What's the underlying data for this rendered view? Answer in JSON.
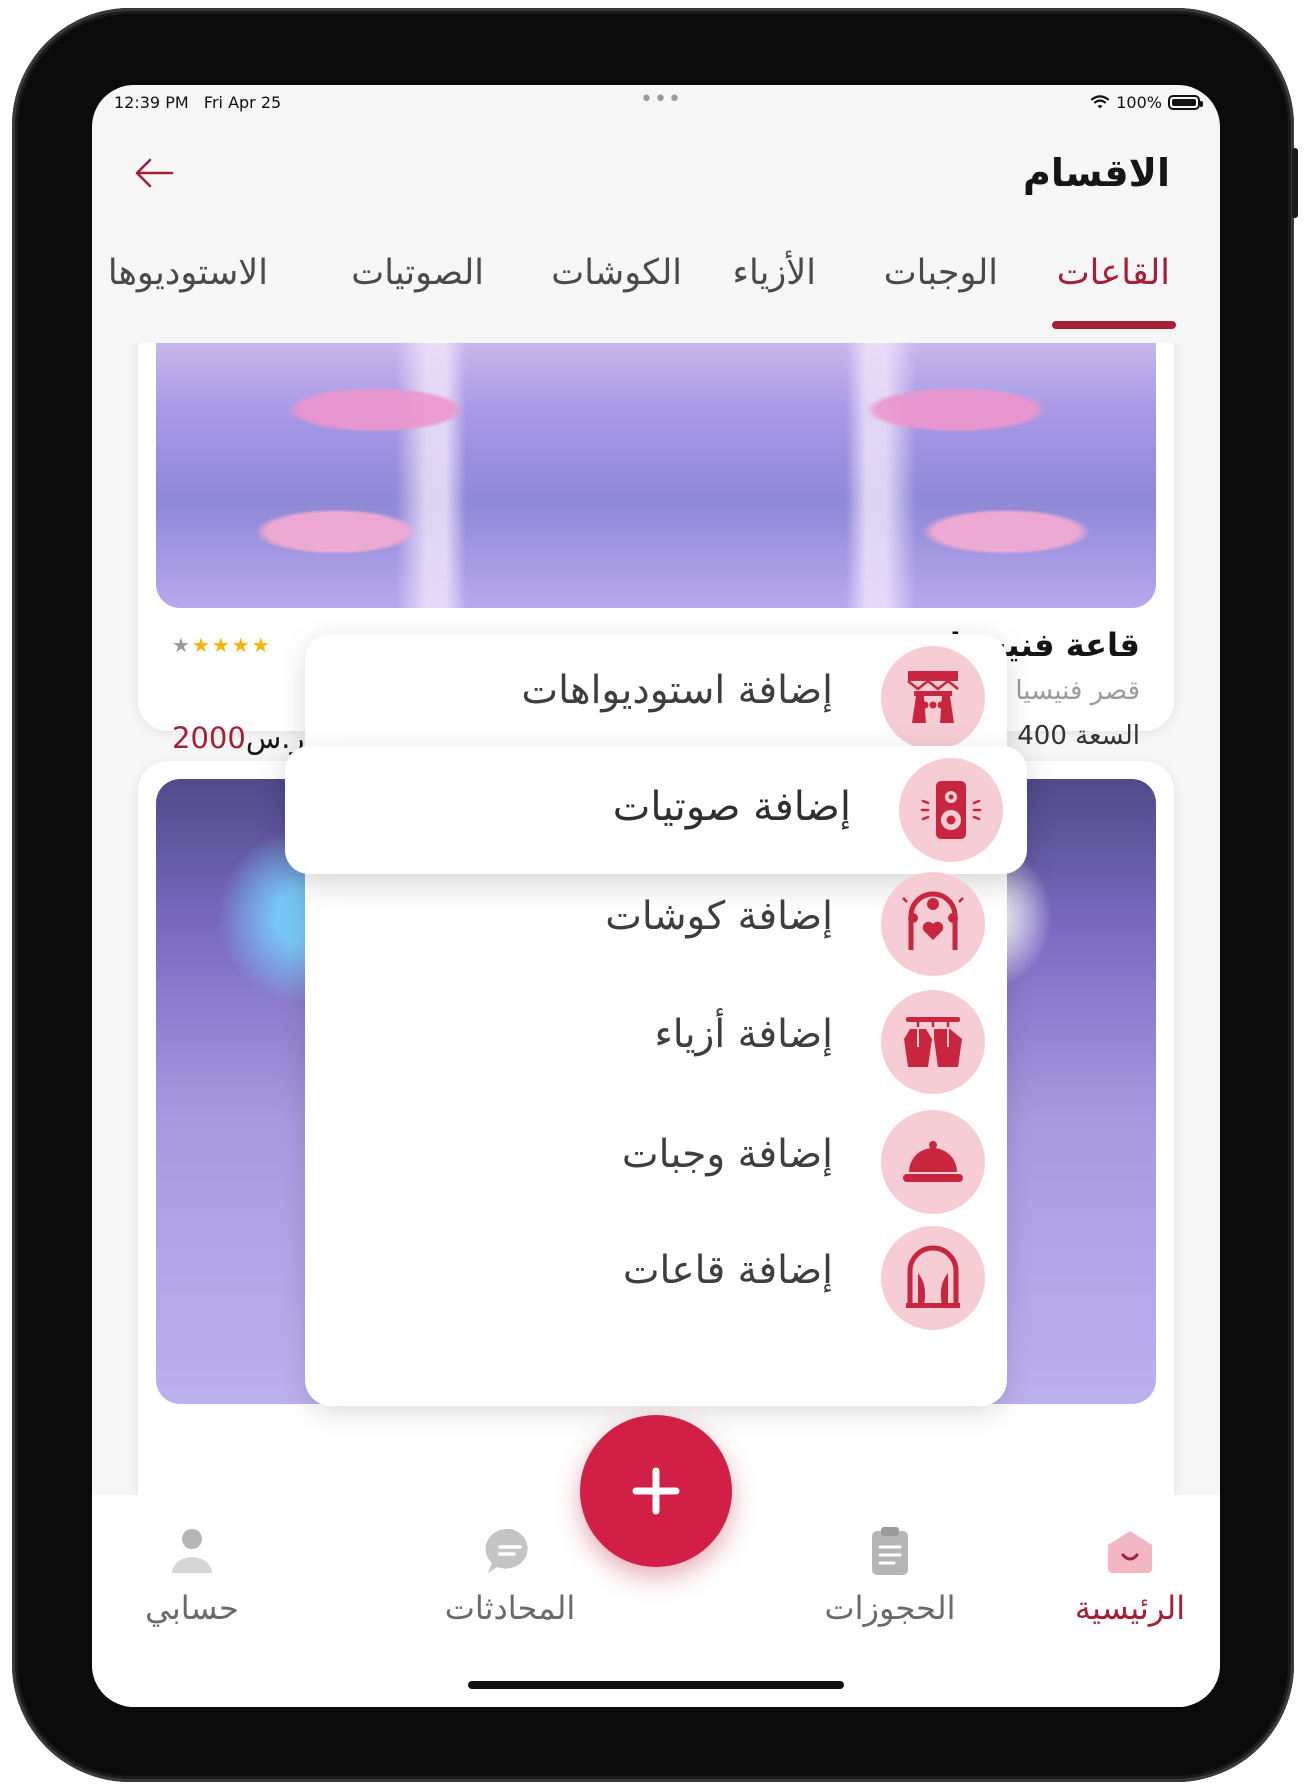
{
  "status_bar": {
    "time": "12:39 PM",
    "date": "Fri Apr 25",
    "battery": "100%"
  },
  "header": {
    "title": "الاقسام"
  },
  "tabs": [
    {
      "label": "القاعات",
      "active": true
    },
    {
      "label": "الوجبات",
      "active": false
    },
    {
      "label": "الأزياء",
      "active": false
    },
    {
      "label": "الكوشات",
      "active": false
    },
    {
      "label": "الصوتيات",
      "active": false
    },
    {
      "label": "الاستوديوها",
      "active": false
    }
  ],
  "cards": [
    {
      "title": "قاعة فنيسيا",
      "location": "قصر فنيسيا",
      "capacity": "السعة 400",
      "price": "2000",
      "currency": "ر.س",
      "rating": 4
    }
  ],
  "add_menu": {
    "items": [
      {
        "label": "إضافة استوديواهات",
        "icon": "studio-icon"
      },
      {
        "label": "إضافة صوتيات",
        "icon": "speaker-icon",
        "highlighted": true
      },
      {
        "label": "إضافة كوشات",
        "icon": "kosha-icon"
      },
      {
        "label": "إضافة أزياء",
        "icon": "clothes-icon"
      },
      {
        "label": "إضافة وجبات",
        "icon": "food-tray-icon"
      },
      {
        "label": "إضافة قاعات",
        "icon": "hall-icon"
      }
    ]
  },
  "bottom_nav": {
    "items": [
      {
        "label": "الرئيسية",
        "icon": "home-icon",
        "active": true
      },
      {
        "label": "الحجوزات",
        "icon": "clipboard-icon",
        "active": false
      },
      {
        "label": "المحادثات",
        "icon": "chat-icon",
        "active": false
      },
      {
        "label": "حسابي",
        "icon": "user-icon",
        "active": false
      }
    ],
    "fab_icon": "plus-icon"
  },
  "colors": {
    "accent": "#a32036",
    "fab": "#d21f45",
    "icon_bg": "#f7cdd5",
    "icon_fg": "#c8263f"
  }
}
